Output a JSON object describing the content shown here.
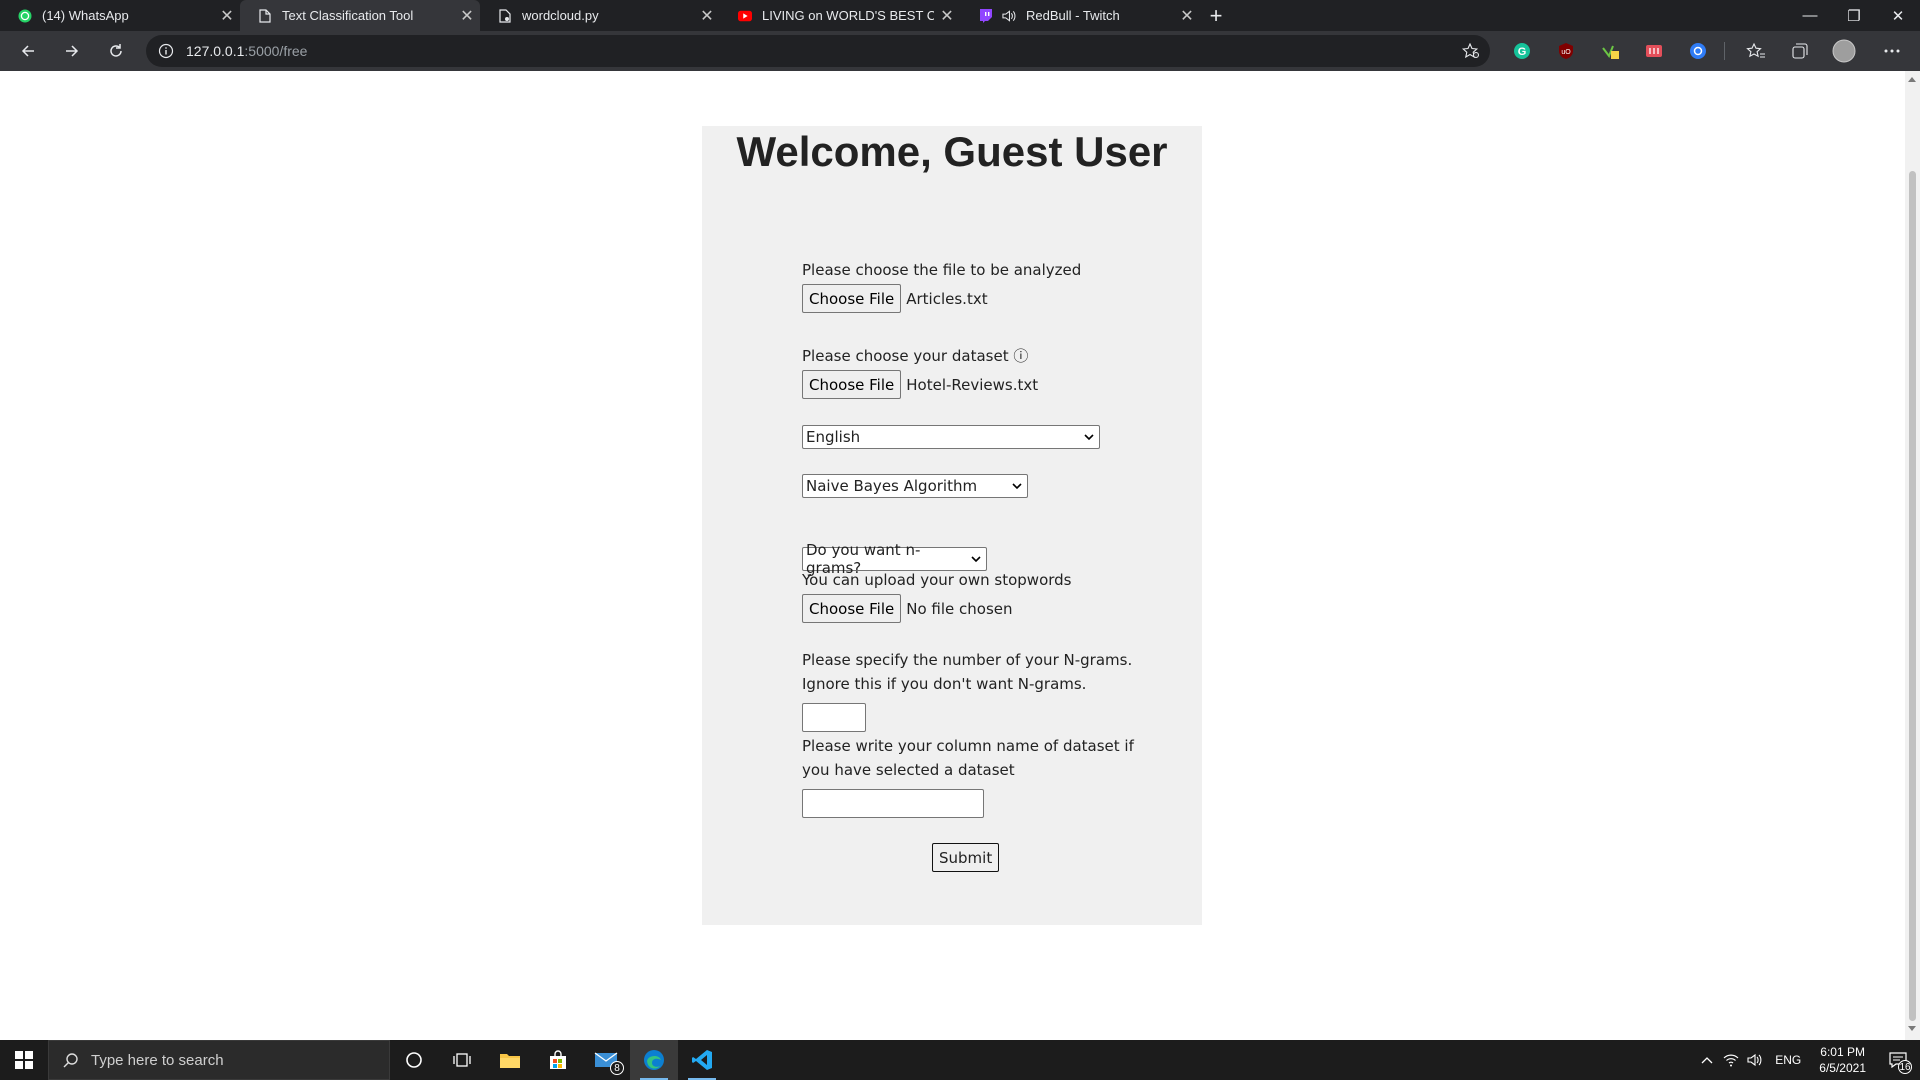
{
  "browser": {
    "tabs": [
      {
        "title": "(14) WhatsApp",
        "icon": "whatsapp-icon",
        "active": false
      },
      {
        "title": "Text Classification Tool",
        "icon": "document-icon",
        "active": true
      },
      {
        "title": "wordcloud.py",
        "icon": "document-icon",
        "active": false
      },
      {
        "title": "LIVING on WORLD'S BEST CHICK",
        "icon": "youtube-icon",
        "active": false
      },
      {
        "title": "RedBull - Twitch",
        "icon": "twitch-icon",
        "active": false
      }
    ],
    "url_host": "127.0.0.1",
    "url_path": ":5000/free"
  },
  "page": {
    "welcome": "Welcome, Guest User",
    "file_label": "Please choose the file to be analyzed",
    "file_button": "Choose File",
    "file_name": "Articles.txt",
    "dataset_label": "Please choose your dataset ⓘ",
    "dataset_button": "Choose File",
    "dataset_name": "Hotel-Reviews.txt",
    "language_value": "English",
    "algorithm_value": "Naive Bayes Algorithm",
    "ngram_value": "Do you want n-grams?",
    "stopwords_label": "You can upload your own stopwords",
    "stopwords_button": "Choose File",
    "stopwords_name": "No file chosen",
    "ngram_count_label_1": "Please specify the number of your N-grams.",
    "ngram_count_label_2": "Ignore this if you don't want N-grams.",
    "column_label_1": "Please write your column name of dataset if",
    "column_label_2": "you have selected a dataset",
    "submit": "Submit"
  },
  "taskbar": {
    "search_placeholder": "Type here to search",
    "mail_badge": "8",
    "language": "ENG",
    "time": "6:01 PM",
    "date": "6/5/2021",
    "notification_count": "16"
  }
}
